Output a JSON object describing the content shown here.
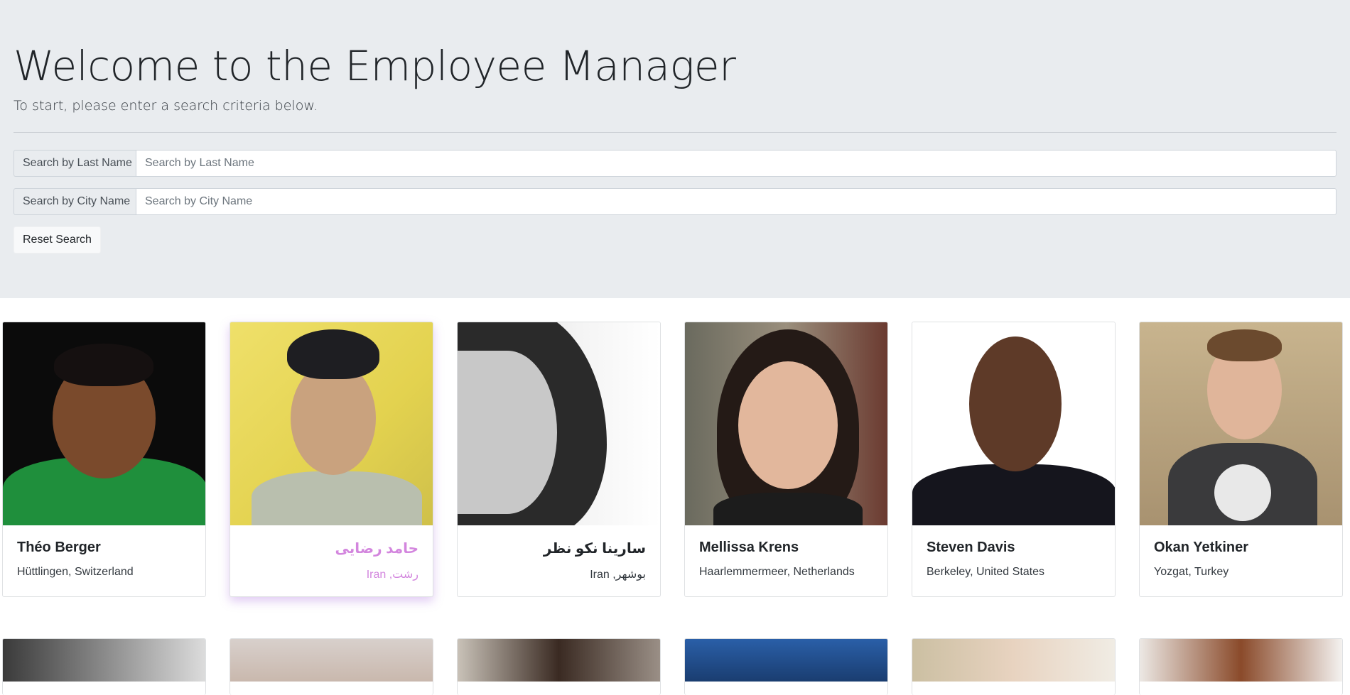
{
  "header": {
    "title": "Welcome to the Employee Manager",
    "subtitle": "To start, please enter a search criteria below."
  },
  "search": {
    "last_name_label": "Search by Last Name",
    "last_name_placeholder": "Search by Last Name",
    "city_label": "Search by City Name",
    "city_placeholder": "Search by City Name",
    "reset_label": "Reset Search"
  },
  "employees": [
    {
      "name": "Théo Berger",
      "location": "Hüttlingen, Switzerland"
    },
    {
      "name": "حامد رضایی",
      "location": "رشت, Iran"
    },
    {
      "name": "سارینا نکو نظر",
      "location": "بوشهر, Iran"
    },
    {
      "name": "Mellissa Krens",
      "location": "Haarlemmermeer, Netherlands"
    },
    {
      "name": "Steven Davis",
      "location": "Berkeley, United States"
    },
    {
      "name": "Okan Yetkiner",
      "location": "Yozgat, Turkey"
    }
  ],
  "colors": {
    "jumbotron_bg": "#e9ecef",
    "active_card_text": "#d386de"
  }
}
